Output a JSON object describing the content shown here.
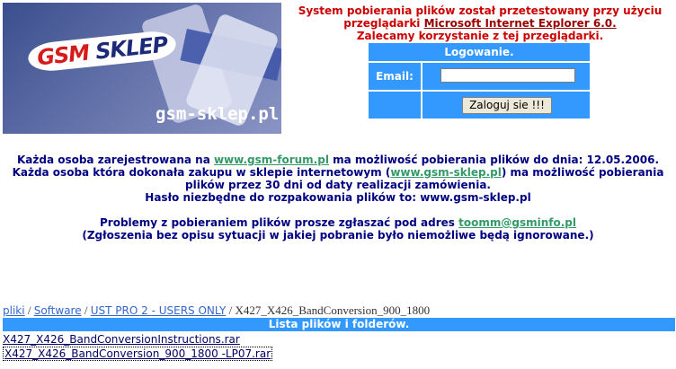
{
  "logo": {
    "brand_gsm": "GSM",
    "brand_sklep": "SKLEP",
    "site": "gsm-sklep.pl"
  },
  "notice": {
    "line1": "System pobierania plików został przetestowany przy użyciu",
    "line2_pre": "przeglądarki ",
    "line2_link": "Microsoft Internet Explorer 6.0.",
    "line3": "Zalecamy korzystanie z tej przeglądarki."
  },
  "login": {
    "header": "Logowanie.",
    "email_label": "Email:",
    "email_value": "",
    "button_label": "Zaloguj sie !!!"
  },
  "info": {
    "p1_pre": "Każda osoba zarejestrowana na ",
    "p1_link": "www.gsm-forum.pl",
    "p1_post": " ma możliwość pobierania plików do dnia: 12.05.2006.",
    "p2_pre": "Każda osoba która dokonała zakupu w sklepie internetowym (",
    "p2_link": "www.gsm-sklep.pl",
    "p2_post": ") ma możliwość pobierania",
    "p3": "plików przez 30 dni od daty realizacji zamówienia.",
    "p4": "Hasło niezbędne do rozpakowania plików to: www.gsm-sklep.pl",
    "p5_pre": "Problemy z pobieraniem plików prosze zgłaszać pod adres ",
    "p5_link": "toomm@gsminfo.pl",
    "p6": "(Zgłoszenia bez opisu sytuacji w jakiej pobranie było niemożliwe będą ignorowane.)"
  },
  "breadcrumb": {
    "item1": "pliki",
    "item2": "Software",
    "item3": "UST PRO 2 - USERS ONLY",
    "current": "X427_X426_BandConversion_900_1800",
    "separator": "/"
  },
  "list": {
    "header": "Lista plików i folderów.",
    "files": [
      "X427_X426_BandConversionInstructions.rar",
      "X427_X426_BandConversion_900_1800 -LP07.rar"
    ]
  }
}
